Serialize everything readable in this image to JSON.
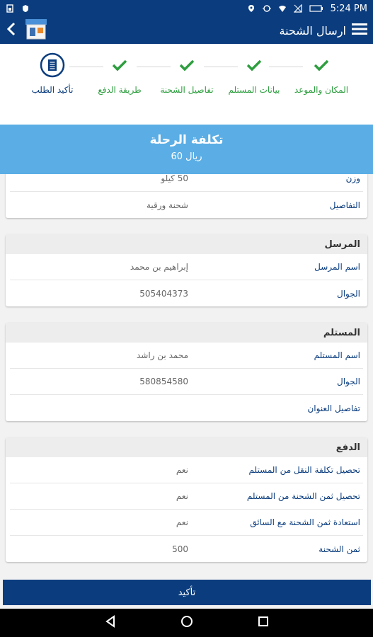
{
  "status_bar": {
    "time": "5:24 PM"
  },
  "app_bar": {
    "title": "ارسال الشحنة"
  },
  "stepper": {
    "steps": [
      {
        "label": "المكان والموعد",
        "done": true
      },
      {
        "label": "بيانات المستلم",
        "done": true
      },
      {
        "label": "تفاصيل الشحنة",
        "done": true
      },
      {
        "label": "طريقة الدفع",
        "done": true
      },
      {
        "label": "تأكيد الطلب",
        "done": false
      }
    ]
  },
  "cost": {
    "title": "تكلفة الرحلة",
    "value": "ريال 60"
  },
  "shipment_card": {
    "rows": [
      {
        "label": "وزن",
        "value": "50 كيلو"
      },
      {
        "label": "التفاصيل",
        "value": "شحنة ورقية"
      }
    ]
  },
  "sender_card": {
    "title": "المرسل",
    "rows": [
      {
        "label": "اسم المرسل",
        "value": "إبراهيم بن محمد"
      },
      {
        "label": "الجوال",
        "value": "505404373"
      }
    ]
  },
  "receiver_card": {
    "title": "المستلم",
    "rows": [
      {
        "label": "اسم المستلم",
        "value": "محمد بن راشد"
      },
      {
        "label": "الجوال",
        "value": "580854580"
      },
      {
        "label": "تفاصيل العنوان",
        "value": ""
      }
    ]
  },
  "payment_card": {
    "title": "الدفع",
    "rows": [
      {
        "label": "تحصيل تكلفة النقل من المستلم",
        "value": "نعم"
      },
      {
        "label": "تحصيل ثمن الشحنة من المستلم",
        "value": "نعم"
      },
      {
        "label": "استعادة ثمن الشحنة مع السائق",
        "value": "نعم"
      },
      {
        "label": "ثمن الشحنة",
        "value": "500"
      }
    ]
  },
  "confirm_button": {
    "label": "تأكيد"
  },
  "colors": {
    "primary": "#0b3d7e",
    "banner": "#5aaee5",
    "success": "#2e9e3f"
  },
  "icons": [
    "back-arrow-icon",
    "store-icon",
    "menu-icon",
    "check-icon",
    "document-icon",
    "nav-back-icon",
    "nav-home-icon",
    "nav-recents-icon"
  ]
}
